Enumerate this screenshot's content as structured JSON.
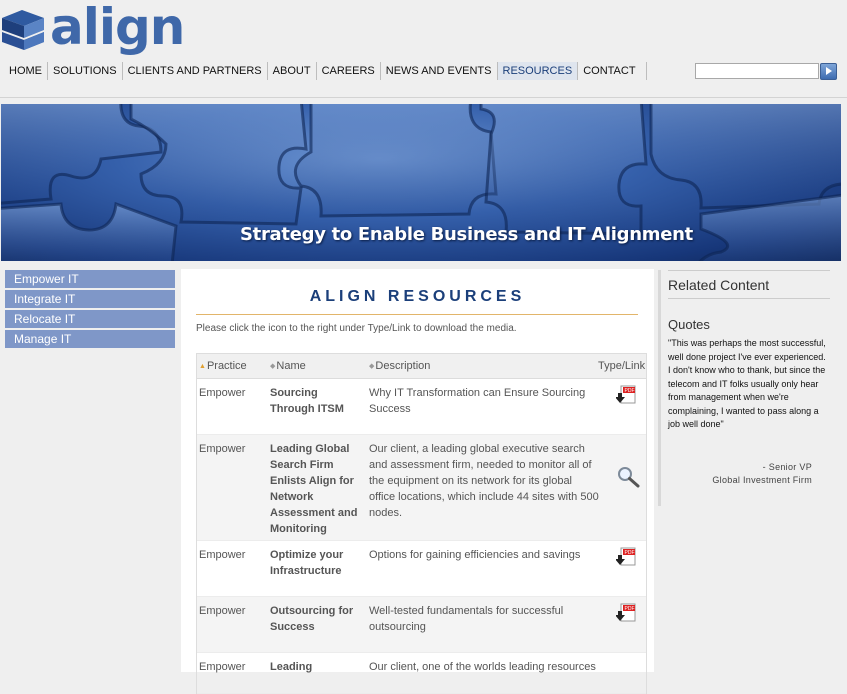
{
  "brand": {
    "name": "align"
  },
  "nav": {
    "items": [
      {
        "label": "HOME"
      },
      {
        "label": "SOLUTIONS"
      },
      {
        "label": "CLIENTS AND PARTNERS"
      },
      {
        "label": "ABOUT"
      },
      {
        "label": "CAREERS"
      },
      {
        "label": "NEWS AND EVENTS"
      },
      {
        "label": "RESOURCES",
        "active": true
      },
      {
        "label": "CONTACT"
      }
    ]
  },
  "search": {
    "value": "",
    "placeholder": ""
  },
  "banner": {
    "caption": "Strategy to Enable Business and IT Alignment"
  },
  "sidebar": {
    "items": [
      {
        "label": "Empower IT"
      },
      {
        "label": "Integrate IT"
      },
      {
        "label": "Relocate IT"
      },
      {
        "label": "Manage IT"
      }
    ]
  },
  "main": {
    "title": "ALIGN RESOURCES",
    "intro": "Please click the icon to the right under Type/Link to download the media.",
    "table": {
      "headers": {
        "practice": "Practice",
        "name": "Name",
        "description": "Description",
        "link": "Type/Link"
      },
      "rows": [
        {
          "practice": "Empower",
          "name": "Sourcing Through ITSM",
          "description": "Why IT Transformation can Ensure Sourcing Success",
          "type": "pdf-download-icon"
        },
        {
          "practice": "Empower",
          "name": "Leading Global Search Firm Enlists Align for Network Assessment and Monitoring",
          "description": "Our client, a leading global executive search and assessment firm, needed to monitor all of the equipment on its network for its global office locations, which include 44 sites with 500 nodes.",
          "type": "magnifier-icon"
        },
        {
          "practice": "Empower",
          "name": "Optimize your Infrastructure",
          "description": "Options for gaining efficiencies and savings",
          "type": "pdf-download-icon"
        },
        {
          "practice": "Empower",
          "name": "Outsourcing for Success",
          "description": "Well-tested fundamentals for successful outsourcing",
          "type": "pdf-download-icon"
        },
        {
          "practice": "Empower",
          "name": "Leading",
          "description": "Our client, one of the worlds leading resources",
          "type": "pdf-download-icon"
        }
      ]
    }
  },
  "related": {
    "title": "Related Content",
    "quotes_title": "Quotes",
    "quote": "\"This was perhaps the most successful, well done project I've ever experienced. I don't know who to thank, but since the telecom and IT folks usually only hear from management when we're complaining, I wanted to pass along a job well done\"",
    "attribution_role": "- Senior VP",
    "attribution_org": "Global Investment Firm"
  },
  "colors": {
    "accent": "#1b3f7a",
    "brand": "#3f68a9",
    "sidebar": "#7f97c8",
    "rule": "#e2b56a"
  }
}
